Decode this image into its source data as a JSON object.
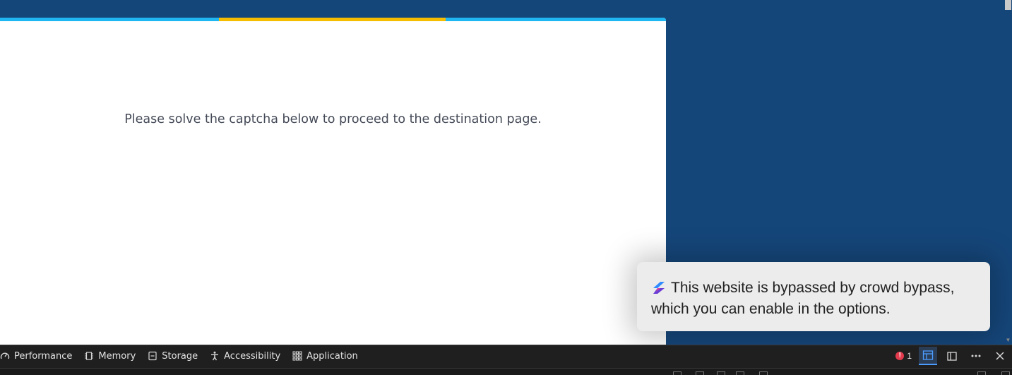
{
  "page": {
    "message": "Please solve the captcha below to proceed to the destination page.",
    "accent_colors": [
      "#1fb6f2",
      "#f6bd00",
      "#1fb6f2"
    ],
    "background_color": "#15467a"
  },
  "toast": {
    "icon": "crowd-bypass-logo-icon",
    "line1": "This website is bypassed by crowd bypass,",
    "line2": "which you can enable in the options."
  },
  "devtools": {
    "tabs": [
      {
        "label": "Performance",
        "icon": "performance-gauge-icon"
      },
      {
        "label": "Memory",
        "icon": "memory-chip-icon"
      },
      {
        "label": "Storage",
        "icon": "storage-icon"
      },
      {
        "label": "Accessibility",
        "icon": "accessibility-person-icon"
      },
      {
        "label": "Application",
        "icon": "application-grid-icon"
      }
    ],
    "error_count": "1"
  }
}
